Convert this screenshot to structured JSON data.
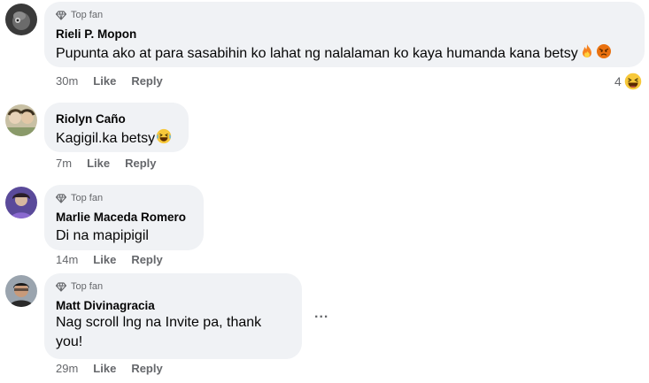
{
  "comments": [
    {
      "badge": "Top fan",
      "author": "Rieli P. Mopon",
      "text": "Pupunta ako at para sasabihin ko lahat ng nalalaman ko kaya humanda kana betsy",
      "emojis": [
        "fire-emoji",
        "angry-emoji"
      ],
      "time": "30m",
      "like_label": "Like",
      "reply_label": "Reply",
      "reaction_count": "4",
      "reaction_emoji": "laughing-emoji"
    },
    {
      "author": "Riolyn Caño",
      "text": "Kagigil.ka betsy",
      "emojis": [
        "laughing-emoji"
      ],
      "time": "7m",
      "like_label": "Like",
      "reply_label": "Reply"
    },
    {
      "badge": "Top fan",
      "author": "Marlie Maceda Romero",
      "text": "Di na mapipigil",
      "time": "14m",
      "like_label": "Like",
      "reply_label": "Reply"
    },
    {
      "badge": "Top fan",
      "author": "Matt Divinagracia",
      "text_lines": [
        "Nag scroll lng na Invite pa, thank",
        "you!"
      ],
      "time": "29m",
      "like_label": "Like",
      "reply_label": "Reply",
      "more_label": "..."
    }
  ],
  "colors": {
    "bubble": "#f0f2f5",
    "meta_text": "#65676b",
    "text": "#050505"
  }
}
